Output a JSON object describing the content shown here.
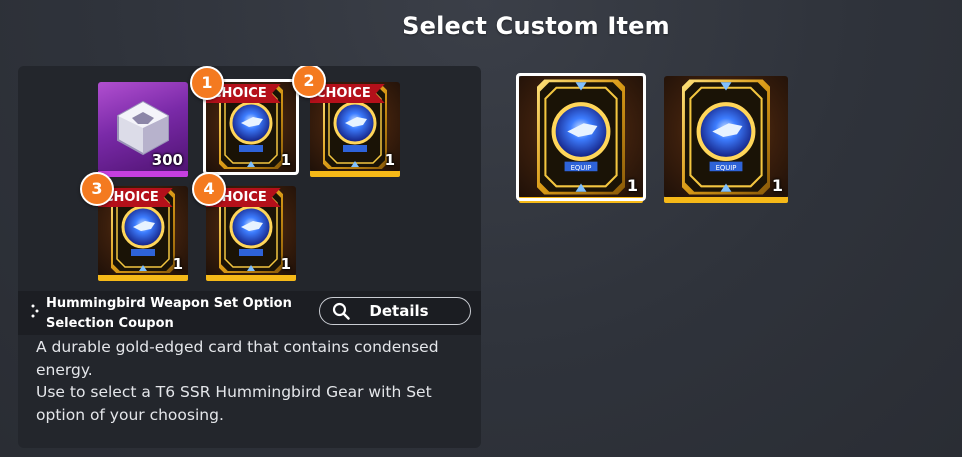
{
  "header": {
    "title": "Select Custom Item"
  },
  "rewards": [
    {
      "kind": "gem-box",
      "quantity": "300"
    },
    {
      "kind": "selection-coupon",
      "choice_label": "CHOICE",
      "badge": "1",
      "quantity": "1",
      "selected": true
    },
    {
      "kind": "selection-coupon",
      "choice_label": "CHOICE",
      "badge": "2",
      "quantity": "1"
    },
    {
      "kind": "selection-coupon",
      "choice_label": "CHOICE",
      "badge": "3",
      "quantity": "1"
    },
    {
      "kind": "selection-coupon",
      "choice_label": "CHOICE",
      "badge": "4",
      "quantity": "1"
    }
  ],
  "item_info": {
    "name_line1": "Hummingbird Weapon Set Option",
    "name_line2": "Selection Coupon",
    "details_label": "Details",
    "description": [
      "A durable gold-edged card that contains condensed",
      "energy.",
      "Use to select a T6 SSR Hummingbird Gear with Set",
      "option of your choosing."
    ]
  },
  "options": [
    {
      "card_text": "EQUIP",
      "quantity": "1",
      "selected": true
    },
    {
      "card_text": "EQUIP",
      "quantity": "1",
      "selected": false
    }
  ],
  "colors": {
    "accent_orange": "#f47a20",
    "choice_red": "#b4101a",
    "gold": "#f6b918",
    "purple": "#c63fe0"
  }
}
